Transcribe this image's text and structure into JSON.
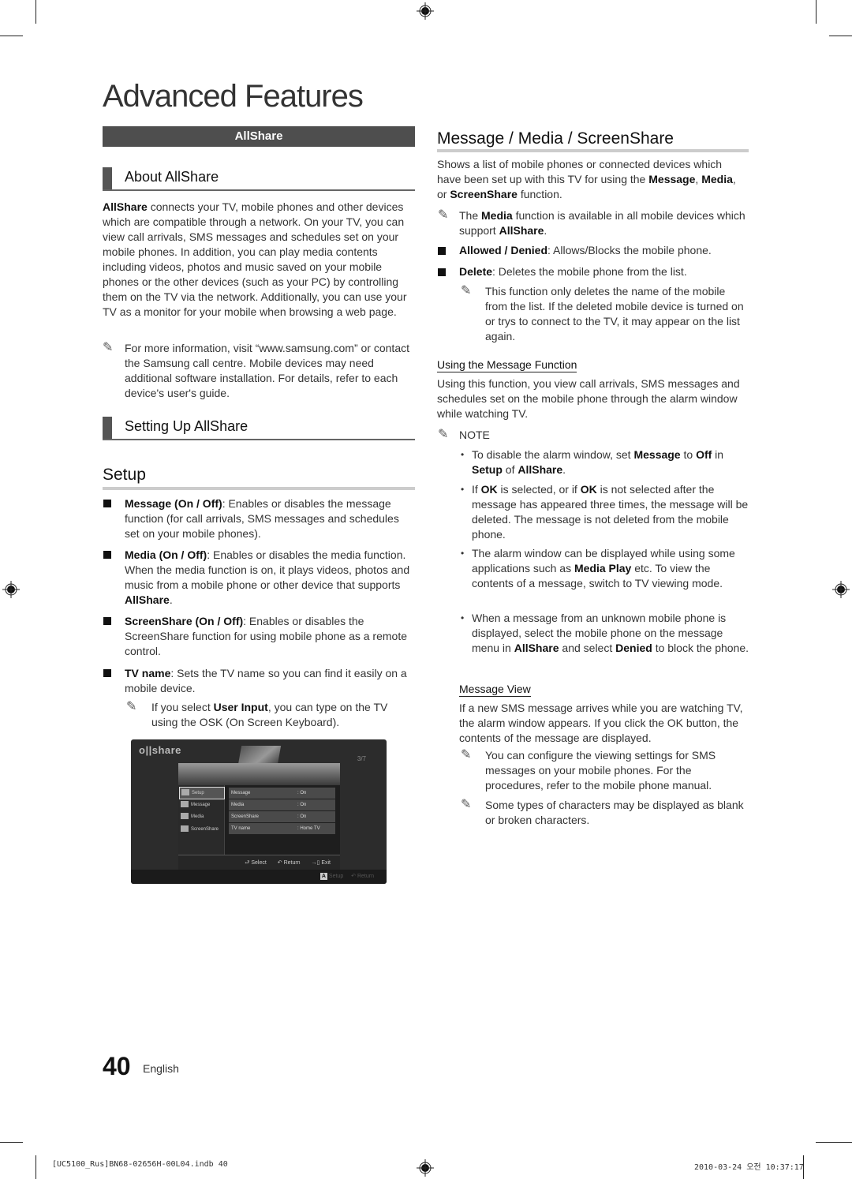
{
  "page": {
    "title": "Advanced Features",
    "section_bar": "AllShare",
    "page_number": "40",
    "language": "English"
  },
  "left": {
    "about": {
      "heading": "About AllShare",
      "body_bold": "AllShare",
      "body": " connects your TV, mobile phones and other devices which are compatible through a network. On your TV, you can view call arrivals, SMS messages and schedules set on your mobile phones. In addition, you can play media contents including videos, photos and music saved on your mobile phones or the other devices (such as your PC) by controlling them on the TV via the network. Additionally, you can use your TV as a monitor for your mobile when browsing a web page.",
      "note": "For more information, visit “www.samsung.com” or contact the Samsung call centre. Mobile devices may need additional software installation. For details, refer to each device's user's guide."
    },
    "setting_up": {
      "heading": "Setting Up AllShare"
    },
    "setup": {
      "heading": "Setup",
      "items": [
        {
          "term": "Message (On / Off)",
          "desc": ": Enables or disables the message function (for call arrivals, SMS messages and schedules set on your mobile phones)."
        },
        {
          "term": "Media (On / Off)",
          "desc": ": Enables or disables the media function. When the media function is on, it plays videos, photos and music from a mobile phone or other device that supports ",
          "desc_bold_tail": "AllShare",
          "desc_tail": "."
        },
        {
          "term": "ScreenShare (On / Off)",
          "desc": ": Enables or disables the ScreenShare function for using mobile phone as a remote control."
        },
        {
          "term": "TV name",
          "desc": ": Sets the TV name so you can find it easily on a mobile device."
        }
      ],
      "tvname_note_pre": "If you select ",
      "tvname_note_bold": "User Input",
      "tvname_note_post": ", you can type on the TV using the OSK (On Screen Keyboard)."
    }
  },
  "tv_screen": {
    "logo": "o||share",
    "page_indicator": "3/7",
    "sidebar": [
      {
        "label": "Setup",
        "icon": "gear-icon",
        "selected": true
      },
      {
        "label": "Message",
        "icon": "envelope-icon",
        "selected": false
      },
      {
        "label": "Media",
        "icon": "media-icon",
        "selected": false
      },
      {
        "label": "ScreenShare",
        "icon": "screenshare-icon",
        "selected": false
      }
    ],
    "settings": [
      {
        "key": "Message",
        "value": ": On"
      },
      {
        "key": "Media",
        "value": ": On"
      },
      {
        "key": "ScreenShare",
        "value": ": On"
      },
      {
        "key": "TV name",
        "value": ": Home TV"
      }
    ],
    "footer": {
      "select": "Select",
      "return": "Return",
      "exit": "Exit"
    },
    "bottom_bar": {
      "a_key": "A",
      "setup": "Setup",
      "return": "Return"
    }
  },
  "right": {
    "heading": "Message / Media / ScreenShare",
    "intro_pre": "Shows a list of mobile phones or connected devices which have been set up with this TV for using the ",
    "intro_b1": "Message",
    "intro_mid1": ", ",
    "intro_b2": "Media",
    "intro_mid2": ", or ",
    "intro_b3": "ScreenShare",
    "intro_post": " function.",
    "media_note_pre": "The ",
    "media_note_b1": "Media",
    "media_note_mid": " function is available in all mobile devices which support ",
    "media_note_b2": "AllShare",
    "media_note_post": ".",
    "allowed_term": "Allowed / Denied",
    "allowed_desc": ": Allows/Blocks the mobile phone.",
    "delete_term": "Delete",
    "delete_desc": ": Deletes the mobile phone from the list.",
    "delete_note": "This function only deletes the name of the mobile from the list. If the deleted mobile device is turned on or trys to connect to the TV, it may appear on the list again.",
    "using_heading": "Using the Message Function",
    "using_body": "Using this function, you view call arrivals, SMS messages and schedules set on the mobile phone through the alarm window while watching TV.",
    "note_label": "NOTE",
    "notes": {
      "n1_pre": "To disable the alarm window, set ",
      "n1_b1": "Message",
      "n1_m1": " to ",
      "n1_b2": "Off",
      "n1_m2": " in ",
      "n1_b3": "Setup",
      "n1_m3": " of ",
      "n1_b4": "AllShare",
      "n1_post": ".",
      "n2_pre": "If ",
      "n2_b1": "OK",
      "n2_m1": " is selected, or if ",
      "n2_b2": "OK",
      "n2_post": " is not selected after the message has appeared three times, the message will be deleted. The message is not deleted from the mobile phone.",
      "n3_pre": "The alarm window can be displayed while using some applications such as ",
      "n3_b1": "Media Play",
      "n3_post": " etc. To view the contents of a message, switch to TV viewing mode.",
      "n4_pre": "When a message from an unknown mobile phone is displayed, select the mobile phone on the message menu in ",
      "n4_b1": "AllShare",
      "n4_m1": " and select ",
      "n4_b2": "Denied",
      "n4_post": " to block the phone."
    },
    "view_heading": "Message View",
    "view_body": "If a new SMS message arrives while you are watching TV, the alarm window appears. If you click the OK button, the contents of the message are displayed.",
    "view_note1": "You can configure the viewing settings for SMS messages on your mobile phones. For the procedures, refer to the mobile phone manual.",
    "view_note2": "Some types of characters may be displayed as blank or broken characters."
  },
  "print_footer": {
    "file": "[UC5100_Rus]BN68-02656H-00L04.indb   40",
    "date": "2010-03-24   오전 10:37:17"
  }
}
